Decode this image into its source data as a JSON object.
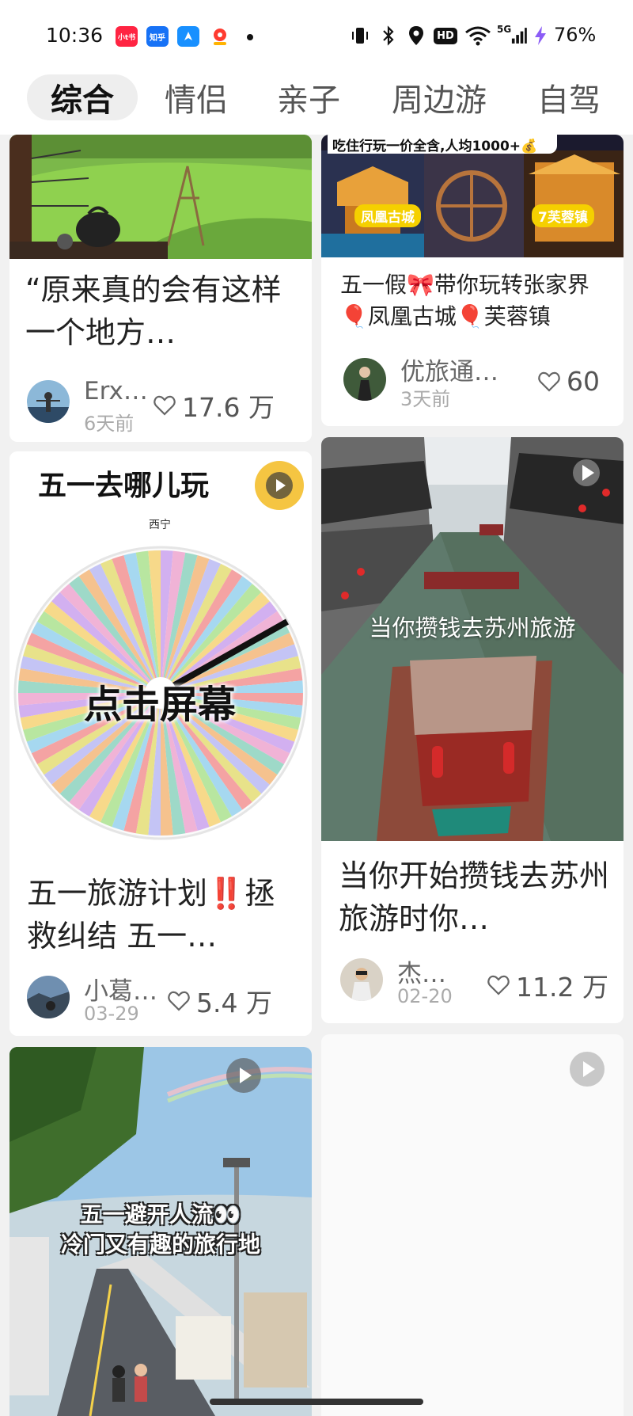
{
  "status_bar": {
    "time": "10:36",
    "apps": [
      {
        "label": "小t书",
        "color": "#ff2442"
      },
      {
        "label": "知乎",
        "color": "#1772f6"
      },
      {
        "label": "",
        "color": "#1890ff"
      },
      {
        "label": "",
        "color": "#f4f4f4"
      }
    ],
    "network": "5G",
    "battery": "76%"
  },
  "tabs": [
    "综合",
    "情侣",
    "亲子",
    "周边游",
    "自驾"
  ],
  "feed": {
    "card1": {
      "title": "“原来真的会有这样一个地方…",
      "author": "Erx…",
      "date": "6天前",
      "likes": "17.6 万"
    },
    "card2": {
      "banner": "吃住行玩一价全含,人均1000+💰",
      "tag_left": "凤凰古城",
      "tag_right": "7芙蓉镇",
      "title": "五一假🎀带你玩转张家界🎈凤凰古城🎈芙蓉镇",
      "author": "优旅通…",
      "date": "3天前",
      "likes": "60"
    },
    "card3": {
      "image_title": "五一去哪儿玩",
      "location": "西宁",
      "wheel_text": "点击屏幕",
      "title": "五一旅游计划‼️拯救纠结 五一…",
      "author": "小葛…",
      "date": "03-29",
      "likes": "5.4 万"
    },
    "card4": {
      "image_caption": "当你攒钱去苏州旅游",
      "title": "当你开始攒钱去苏州旅游时你…",
      "author": "杰…",
      "date": "02-20",
      "likes": "11.2 万"
    },
    "card5": {
      "image_text_line1": "五一避开人流👀",
      "image_text_line2": "冷门又有趣的旅行地"
    }
  }
}
